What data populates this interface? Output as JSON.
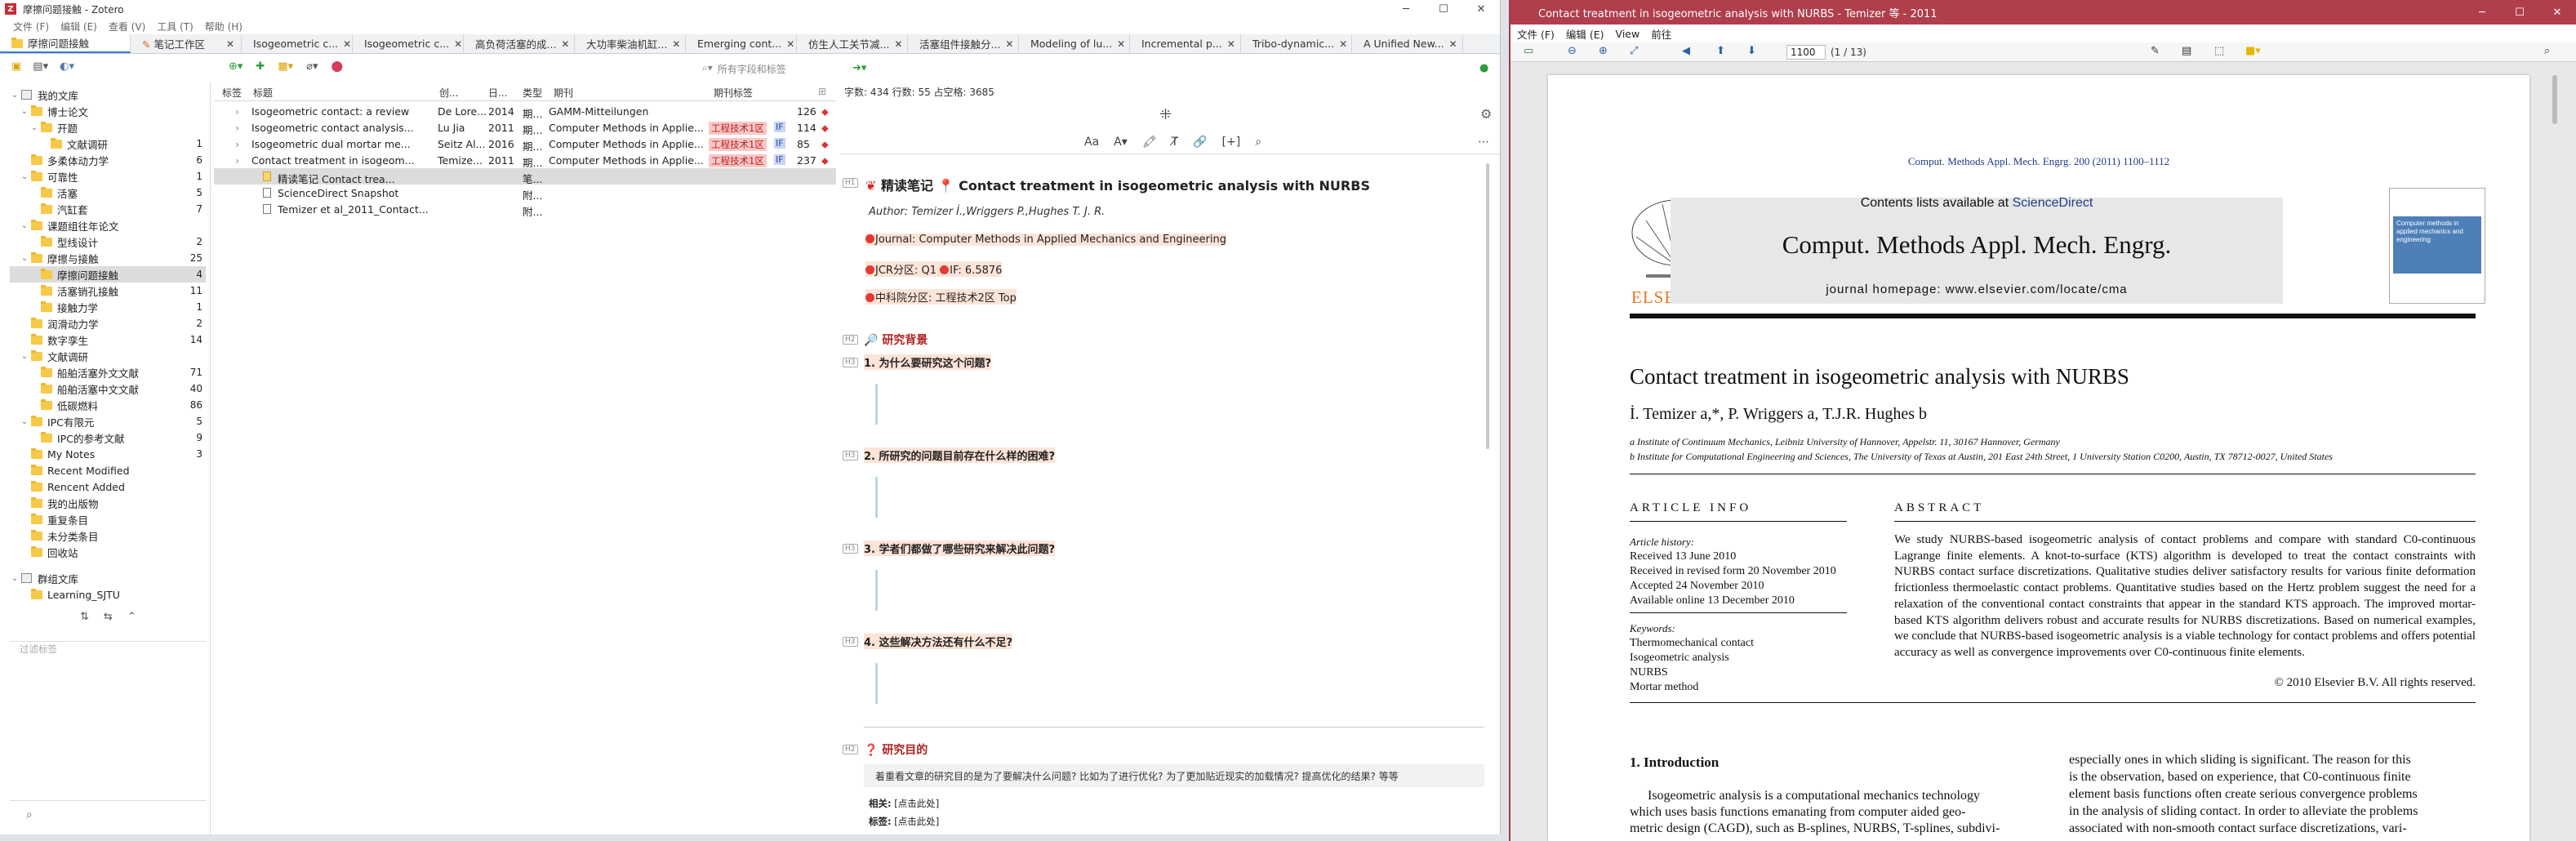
{
  "zotero": {
    "window_title": "摩擦问题接触 - Zotero",
    "menu": [
      "文件 (F)",
      "编辑 (E)",
      "查看 (V)",
      "工具 (T)",
      "帮助 (H)"
    ],
    "tabs": [
      {
        "label": "摩擦问题接触"
      },
      {
        "label": "笔记工作区"
      },
      {
        "label": "Isogeometric c..."
      },
      {
        "label": "Isogeometric c..."
      },
      {
        "label": "高负荷活塞的成..."
      },
      {
        "label": "大功率柴油机缸..."
      },
      {
        "label": "Emerging cont..."
      },
      {
        "label": "仿生人工关节减..."
      },
      {
        "label": "活塞组件接触分..."
      },
      {
        "label": "Modeling of lu..."
      },
      {
        "label": "Incremental p..."
      },
      {
        "label": "Tribo-dynamic..."
      },
      {
        "label": "A Unified New..."
      }
    ],
    "search_placeholder": "所有字段和标签",
    "tree": [
      {
        "label": "我的文库",
        "count": "",
        "level": 0,
        "icon": "library"
      },
      {
        "label": "博士论文",
        "count": "",
        "level": 1
      },
      {
        "label": "开题",
        "count": "",
        "level": 2
      },
      {
        "label": "文献调研",
        "count": "1",
        "level": 3
      },
      {
        "label": "多柔体动力学",
        "count": "6",
        "level": 1
      },
      {
        "label": "可靠性",
        "count": "1",
        "level": 1
      },
      {
        "label": "活塞",
        "count": "5",
        "level": 2
      },
      {
        "label": "汽缸套",
        "count": "7",
        "level": 2
      },
      {
        "label": "课题组往年论文",
        "count": "",
        "level": 1
      },
      {
        "label": "型线设计",
        "count": "2",
        "level": 2
      },
      {
        "label": "摩擦与接触",
        "count": "25",
        "level": 1
      },
      {
        "label": "摩擦问题接触",
        "count": "4",
        "level": 2
      },
      {
        "label": "活塞销孔接触",
        "count": "11",
        "level": 2
      },
      {
        "label": "接触力学",
        "count": "1",
        "level": 2
      },
      {
        "label": "润滑动力学",
        "count": "2",
        "level": 1
      },
      {
        "label": "数字孪生",
        "count": "14",
        "level": 1
      },
      {
        "label": "文献调研",
        "count": "",
        "level": 1
      },
      {
        "label": "船舶活塞外文文献",
        "count": "71",
        "level": 2
      },
      {
        "label": "船舶活塞中文文献",
        "count": "40",
        "level": 2
      },
      {
        "label": "低碳燃料",
        "count": "86",
        "level": 2
      },
      {
        "label": "IPC有限元",
        "count": "5",
        "level": 1
      },
      {
        "label": "IPC的参考文献",
        "count": "9",
        "level": 2
      },
      {
        "label": "My Notes",
        "count": "3",
        "level": 1
      },
      {
        "label": "Recent Modified",
        "count": "",
        "level": 1
      },
      {
        "label": "Rencent Added",
        "count": "",
        "level": 1
      },
      {
        "label": "我的出版物",
        "count": "",
        "level": 1
      },
      {
        "label": "重复条目",
        "count": "",
        "level": 1
      },
      {
        "label": "未分类条目",
        "count": "",
        "level": 1
      },
      {
        "label": "回收站",
        "count": "",
        "level": 1
      },
      {
        "label": "群组文库",
        "count": "",
        "level": 0
      },
      {
        "label": "Learning_SJTU",
        "count": "",
        "level": 1
      }
    ],
    "tag_filter_placeholder": "过滤标签",
    "columns": [
      "标签",
      "标题",
      "创...",
      "日...",
      "类型",
      "期刊",
      "期刊标签"
    ],
    "items": [
      {
        "title": "Isogeometric contact: a review",
        "creator": "De Lore...",
        "year": "2014",
        "type": "期...",
        "journal": "GAMM-Mitteilungen",
        "tag": "",
        "if": "",
        "cites": "126"
      },
      {
        "title": "Isogeometric contact analysis...",
        "creator": "Lu Jia",
        "year": "2011",
        "type": "期...",
        "journal": "Computer Methods in Applie...",
        "tag": "工程技术1区",
        "if": "IF",
        "cites": "114"
      },
      {
        "title": "Isogeometric dual mortar me...",
        "creator": "Seitz Al...",
        "year": "2016",
        "type": "期...",
        "journal": "Computer Methods in Applie...",
        "tag": "工程技术1区",
        "if": "IF",
        "cites": "85"
      },
      {
        "title": "Contact treatment in isogeom...",
        "creator": "Temize...",
        "year": "2011",
        "type": "期...",
        "journal": "Computer Methods in Applie...",
        "tag": "工程技术1区",
        "if": "IF",
        "cites": "237"
      }
    ],
    "children": [
      {
        "title": "精读笔记 Contact trea...",
        "type": "笔..."
      },
      {
        "title": "ScienceDirect Snapshot",
        "type": "附..."
      },
      {
        "title": "Temizer et al_2011_Contact...",
        "type": "附..."
      }
    ],
    "note": {
      "stats": "字数: 434 行数: 55 占空格: 3685",
      "title_prefix": "精读笔记",
      "title": "Contact treatment in isogeometric analysis with NURBS",
      "author": "Author: Temizer İ.,Wriggers P.,Hughes T. J. R.",
      "journal": "Journal: Computer Methods in Applied Mechanics and Engineering",
      "jcr": "JCR分区: Q1",
      "if": "IF: 6.5876",
      "cas": "中科院分区: 工程技术2区 Top",
      "section1": "研究背景",
      "q1": "1. 为什么要研究这个问题?",
      "q2": "2. 所研究的问题目前存在什么样的困难?",
      "q3": "3. 学者们都做了哪些研究来解决此问题?",
      "q4": "4. 这些解决方法还有什么不足?",
      "section2": "研究目的",
      "purpose": "着重看文章的研究目的是为了要解决什么问题? 比如为了进行优化? 为了更加贴近现实的加载情况? 提高优化的结果? 等等",
      "related_label": "相关:",
      "related_value": "[点击此处]",
      "tag_label": "标签:",
      "tag_value": "[点击此处]"
    }
  },
  "reader": {
    "window_title": "Contact treatment in isogeometric analysis with NURBS - Temizer 等 - 2011",
    "menu": [
      "文件 (F)",
      "编辑 (E)",
      "View",
      "前往"
    ],
    "page_field": "1100",
    "page_info": "(1 / 13)",
    "pdf": {
      "journal_ref": "Comput. Methods Appl. Mech. Engrg. 200 (2011) 1100–1112",
      "contents_prefix": "Contents lists available at ",
      "contents_link": "ScienceDirect",
      "journal_name": "Comput. Methods Appl. Mech. Engrg.",
      "homepage": "journal homepage: www.elsevier.com/locate/cma",
      "publisher": "ELSEVIER",
      "cover_text": "Computer methods in applied mechanics and engineering",
      "title": "Contact treatment in isogeometric analysis with NURBS",
      "authors": "İ. Temizer a,*, P. Wriggers a, T.J.R. Hughes b",
      "affil_a": "a Institute of Continuum Mechanics, Leibniz University of Hannover, Appelstr. 11, 30167 Hannover, Germany",
      "affil_b": "b Institute for Computational Engineering and Sciences, The University of Texas at Austin, 201 East 24th Street, 1 University Station C0200, Austin, TX 78712-0027, United States",
      "article_info_head": "ARTICLE INFO",
      "abstract_head": "ABSTRACT",
      "history_label": "Article history:",
      "history": [
        "Received 13 June 2010",
        "Received in revised form 20 November 2010",
        "Accepted 24 November 2010",
        "Available online 13 December 2010"
      ],
      "keywords_label": "Keywords:",
      "keywords": [
        "Thermomechanical contact",
        "Isogeometric analysis",
        "NURBS",
        "Mortar method"
      ],
      "abstract": "We study NURBS-based isogeometric analysis of contact problems and compare with standard C0-continuous Lagrange finite elements. A knot-to-surface (KTS) algorithm is developed to treat the contact constraints with NURBS contact surface discretizations. Qualitative studies deliver satisfactory results for various finite deformation frictionless thermoelastic contact problems. Quantitative studies based on the Hertz problem suggest the need for a relaxation of the conventional contact constraints that appear in the standard KTS approach. The improved mortar-based KTS algorithm delivers robust and accurate results for NURBS discretizations. Based on numerical examples, we conclude that NURBS-based isogeometric analysis is a viable technology for contact problems and offers potential accuracy as well as convergence improvements over C0-continuous finite elements.",
      "copyright": "© 2010 Elsevier B.V. All rights reserved.",
      "intro_head": "1. Introduction",
      "intro_left": [
        "Isogeometric analysis is a computational mechanics technology",
        "which uses basis functions emanating from computer aided geo-",
        "metric design (CAGD), such as B-splines, NURBS, T-splines, subdivi-"
      ],
      "intro_right": [
        "especially ones in which sliding is significant. The reason for this",
        "is the observation, based on experience, that C0-continuous finite",
        "element basis functions often create serious convergence problems",
        "in the analysis of sliding contact. In order to alleviate the problems",
        "associated with non-smooth contact surface discretizations, vari-"
      ]
    }
  },
  "colors": {
    "zotero_red": "#cc2936",
    "reader_titlebar": "#b03e4c",
    "selection": "#dcdcdc",
    "tag_red_bg": "#f8c8c8",
    "tag_blue_bg": "#c7d4f5",
    "science_direct_link": "#1f3c8a",
    "elsevier_orange": "#e87722"
  }
}
